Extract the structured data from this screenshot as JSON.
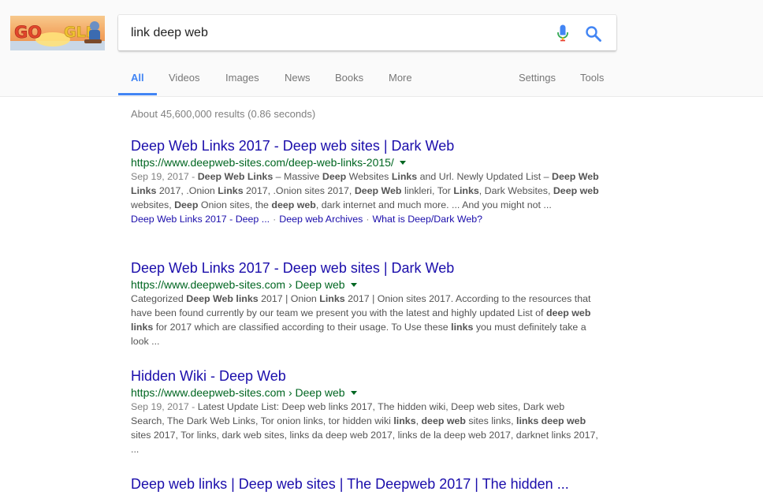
{
  "search": {
    "query": "link deep web",
    "logo_text": "GO GLE"
  },
  "tabs": [
    {
      "label": "All",
      "active": true
    },
    {
      "label": "Videos"
    },
    {
      "label": "Images"
    },
    {
      "label": "News"
    },
    {
      "label": "Books"
    },
    {
      "label": "More"
    },
    {
      "label": "Settings"
    },
    {
      "label": "Tools"
    }
  ],
  "stats": "About 45,600,000 results (0.86 seconds)",
  "results": [
    {
      "title": "Deep Web Links 2017 - Deep web sites | Dark Web",
      "url": "https://www.deepweb-sites.com/deep-web-links-2015/",
      "snippet": [
        {
          "t": "Sep 19, 2017 - ",
          "date": true
        },
        {
          "t": "Deep Web Links",
          "b": true
        },
        {
          "t": " – Massive "
        },
        {
          "t": "Deep",
          "b": true
        },
        {
          "t": " Websites "
        },
        {
          "t": "Links",
          "b": true
        },
        {
          "t": " and Url. Newly Updated List – "
        },
        {
          "t": "Deep Web Links",
          "b": true
        },
        {
          "t": " 2017, .Onion "
        },
        {
          "t": "Links",
          "b": true
        },
        {
          "t": " 2017, .Onion sites 2017, "
        },
        {
          "t": "Deep Web",
          "b": true
        },
        {
          "t": " linkleri, Tor "
        },
        {
          "t": "Links",
          "b": true
        },
        {
          "t": ", Dark Websites, "
        },
        {
          "t": "Deep web",
          "b": true
        },
        {
          "t": " websites, "
        },
        {
          "t": "Deep",
          "b": true
        },
        {
          "t": " Onion sites, the "
        },
        {
          "t": "deep web",
          "b": true
        },
        {
          "t": ", dark internet and much more. ... And you might not ..."
        }
      ],
      "sitelinks": [
        "Deep Web Links 2017 - Deep ...",
        "Deep web Archives",
        "What is Deep/Dark Web?"
      ]
    },
    {
      "title": "Deep Web Links 2017 - Deep web sites | Dark Web",
      "url": "https://www.deepweb-sites.com › Deep web",
      "snippet": [
        {
          "t": "Categorized "
        },
        {
          "t": "Deep Web links",
          "b": true
        },
        {
          "t": " 2017 | Onion "
        },
        {
          "t": "Links",
          "b": true
        },
        {
          "t": " 2017 | Onion sites 2017. According to the resources that have been found currently by our team we present you with the latest and highly updated List of "
        },
        {
          "t": "deep web links",
          "b": true
        },
        {
          "t": " for 2017 which are classified according to their usage. To Use these "
        },
        {
          "t": "links",
          "b": true
        },
        {
          "t": " you must definitely take a look ..."
        }
      ]
    },
    {
      "title": "Hidden Wiki - Deep Web",
      "url": "https://www.deepweb-sites.com › Deep web",
      "snippet": [
        {
          "t": "Sep 19, 2017 - ",
          "date": true
        },
        {
          "t": "Latest Update List: Deep web links 2017, The hidden wiki, Deep web sites, Dark web Search, The Dark Web Links, Tor onion links, tor hidden wiki "
        },
        {
          "t": "links",
          "b": true
        },
        {
          "t": ", "
        },
        {
          "t": "deep web",
          "b": true
        },
        {
          "t": " sites links, "
        },
        {
          "t": "links deep web",
          "b": true
        },
        {
          "t": " sites 2017, Tor links, dark web sites, links da deep web 2017, links de la deep web 2017, darknet links 2017, ..."
        }
      ]
    },
    {
      "title": "Deep web links | Deep web sites | The Deepweb 2017 | The hidden ..."
    }
  ],
  "colors": {
    "link": "#1a0dab",
    "url": "#006621",
    "snippet": "#545454",
    "accent": "#4285f4"
  },
  "icons": {
    "mic": "microphone-icon",
    "search": "magnifier-icon",
    "caret": "caret-down-icon"
  }
}
